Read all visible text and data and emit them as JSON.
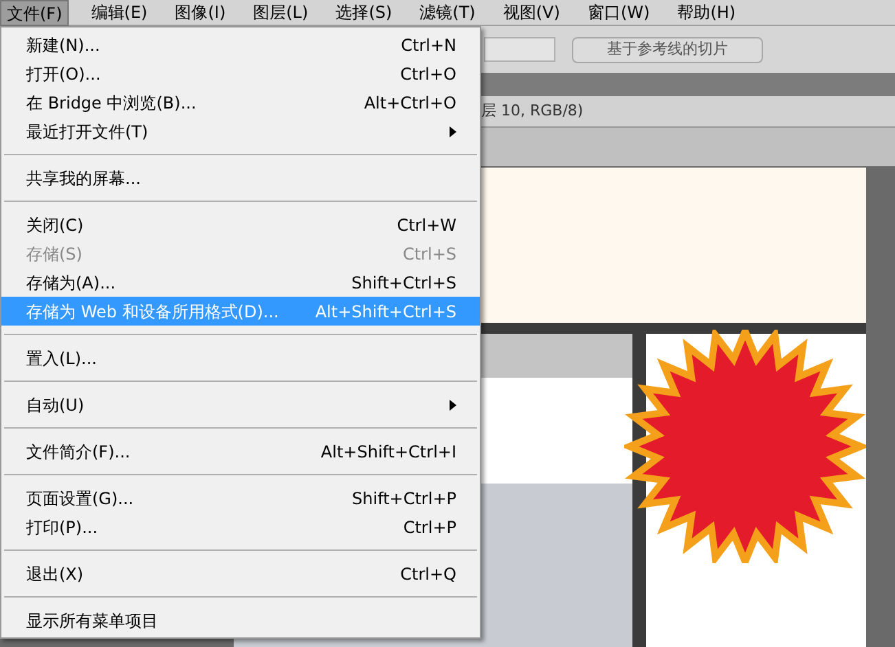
{
  "menubar": [
    {
      "label": "文件(F)",
      "selected": true
    },
    {
      "label": "编辑(E)",
      "selected": false
    },
    {
      "label": "图像(I)",
      "selected": false
    },
    {
      "label": "图层(L)",
      "selected": false
    },
    {
      "label": "选择(S)",
      "selected": false
    },
    {
      "label": "滤镜(T)",
      "selected": false
    },
    {
      "label": "视图(V)",
      "selected": false
    },
    {
      "label": "窗口(W)",
      "selected": false
    },
    {
      "label": "帮助(H)",
      "selected": false
    }
  ],
  "options_bar": {
    "slice_button": "基于参考线的切片"
  },
  "document_tab": {
    "title": "层 10, RGB/8)"
  },
  "file_menu": [
    {
      "kind": "item",
      "label": "新建(N)...",
      "shortcut": "Ctrl+N",
      "selected": false,
      "disabled": false
    },
    {
      "kind": "item",
      "label": "打开(O)...",
      "shortcut": "Ctrl+O",
      "selected": false,
      "disabled": false
    },
    {
      "kind": "item",
      "label": "在 Bridge 中浏览(B)...",
      "shortcut": "Alt+Ctrl+O",
      "selected": false,
      "disabled": false
    },
    {
      "kind": "submenu",
      "label": "最近打开文件(T)",
      "selected": false,
      "disabled": false
    },
    {
      "kind": "separator"
    },
    {
      "kind": "item",
      "label": "共享我的屏幕...",
      "selected": false,
      "disabled": false
    },
    {
      "kind": "separator"
    },
    {
      "kind": "item",
      "label": "关闭(C)",
      "shortcut": "Ctrl+W",
      "selected": false,
      "disabled": false
    },
    {
      "kind": "item",
      "label": "存储(S)",
      "shortcut": "Ctrl+S",
      "selected": false,
      "disabled": true
    },
    {
      "kind": "item",
      "label": "存储为(A)...",
      "shortcut": "Shift+Ctrl+S",
      "selected": false,
      "disabled": false
    },
    {
      "kind": "item",
      "label": "存储为 Web 和设备所用格式(D)...",
      "shortcut": "Alt+Shift+Ctrl+S",
      "selected": true,
      "disabled": false
    },
    {
      "kind": "separator"
    },
    {
      "kind": "item",
      "label": "置入(L)...",
      "selected": false,
      "disabled": false
    },
    {
      "kind": "separator"
    },
    {
      "kind": "submenu",
      "label": "自动(U)",
      "selected": false,
      "disabled": false
    },
    {
      "kind": "separator"
    },
    {
      "kind": "item",
      "label": "文件简介(F)...",
      "shortcut": "Alt+Shift+Ctrl+I",
      "selected": false,
      "disabled": false
    },
    {
      "kind": "separator"
    },
    {
      "kind": "item",
      "label": "页面设置(G)...",
      "shortcut": "Shift+Ctrl+P",
      "selected": false,
      "disabled": false
    },
    {
      "kind": "item",
      "label": "打印(P)...",
      "shortcut": "Ctrl+P",
      "selected": false,
      "disabled": false
    },
    {
      "kind": "separator"
    },
    {
      "kind": "item",
      "label": "退出(X)",
      "shortcut": "Ctrl+Q",
      "selected": false,
      "disabled": false
    },
    {
      "kind": "separator"
    },
    {
      "kind": "item",
      "label": "显示所有菜单项目",
      "selected": false,
      "disabled": false
    }
  ]
}
